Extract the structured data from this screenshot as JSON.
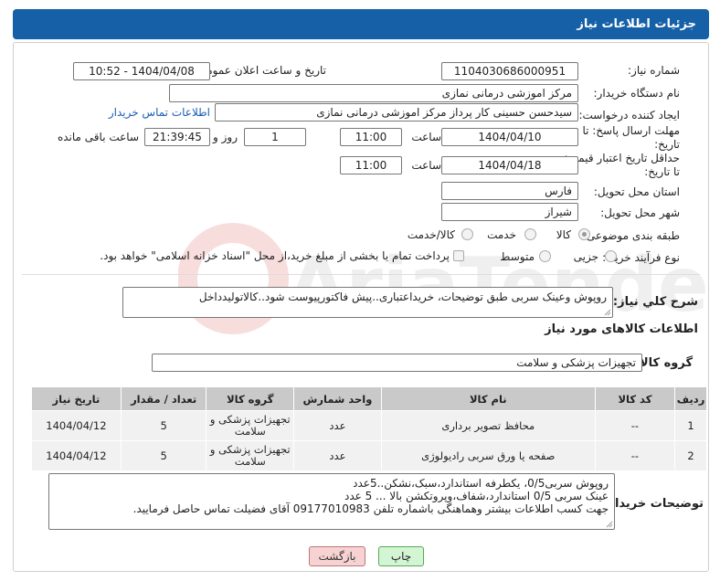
{
  "header": {
    "title": "جزئیات اطلاعات نیاز"
  },
  "form": {
    "need_number_label": "شماره نیاز:",
    "need_number": "1104030686000951",
    "announce_label": "تاریخ و ساعت اعلان عمومی:",
    "announce_value": "1404/04/08 - 10:52",
    "buyer_org_label": "نام دستگاه خریدار:",
    "buyer_org": "مرکز اموزشی درمانی نمازی",
    "requester_label": "ایجاد کننده درخواست:",
    "requester": "سیدحسن حسینی کار پرداز مرکز اموزشی درمانی نمازی",
    "contact_link": "اطلاعات تماس خریدار",
    "reply_deadline_label": "مهلت ارسال پاسخ: تا تاریخ:",
    "reply_date": "1404/04/10",
    "time_label": "ساعت",
    "reply_time": "11:00",
    "days_value": "1",
    "days_label": "روز و",
    "remaining_time": "21:39:45",
    "remaining_label": "ساعت باقی مانده",
    "min_validity_label": "حداقل تاریخ اعتبار قیمت: تا تاریخ:",
    "validity_date": "1404/04/18",
    "validity_time": "11:00",
    "province_label": "استان محل تحویل:",
    "province": "فارس",
    "city_label": "شهر محل تحویل:",
    "city": "شیراز",
    "category_label": "طبقه بندی موضوعی:",
    "category_options": [
      "کالا",
      "خدمت",
      "کالا/خدمت"
    ],
    "process_label": "نوع فرآیند خرید :",
    "process_options": [
      "جزیی",
      "متوسط"
    ],
    "payment_note": "پرداخت تمام یا بخشی از مبلغ خرید،از محل \"اسناد خزانه اسلامی\" خواهد بود."
  },
  "description": {
    "label": "شرح کلي نياز:",
    "text": "روپوش وعینک سربی طبق توضیحات، خریداعتباری..پیش فاکتورپیوست شود..کالاتولیدداخل"
  },
  "goods": {
    "section_title": "اطلاعات کالاهای مورد نیاز",
    "group_label": "گروه کالا:",
    "group_value": "تجهیزات پزشکی و سلامت",
    "columns": [
      "ردیف",
      "کد کالا",
      "نام کالا",
      "واحد شمارش",
      "گروه کالا",
      "تعداد / مقدار",
      "تاریخ نیاز"
    ],
    "rows": [
      [
        "1",
        "--",
        "محافظ تصویر برداری",
        "عدد",
        "تجهیزات پزشکی و سلامت",
        "5",
        "1404/04/12"
      ],
      [
        "2",
        "--",
        "صفحه یا ورق سربی رادیولوژی",
        "عدد",
        "تجهیزات پزشکی و سلامت",
        "5",
        "1404/04/12"
      ]
    ]
  },
  "buyer_notes": {
    "label": "توضیحات خریدار:",
    "lines": [
      "روپوش سربی0/5، یکطرفه استاندارد،سبک،نشکن..5عدد",
      "عینک سربی 0/5 استاندارد،شفاف،وپروتکشن بالا ... 5 عدد",
      "جهت کسب اطلاعات بیشتر وهماهنگی باشماره تلفن 09177010983 آقای فضیلت تماس حاصل فرمایید."
    ]
  },
  "buttons": {
    "print": "چاپ",
    "back": "بازگشت"
  },
  "watermark": {
    "text": "AriaTender.net"
  }
}
